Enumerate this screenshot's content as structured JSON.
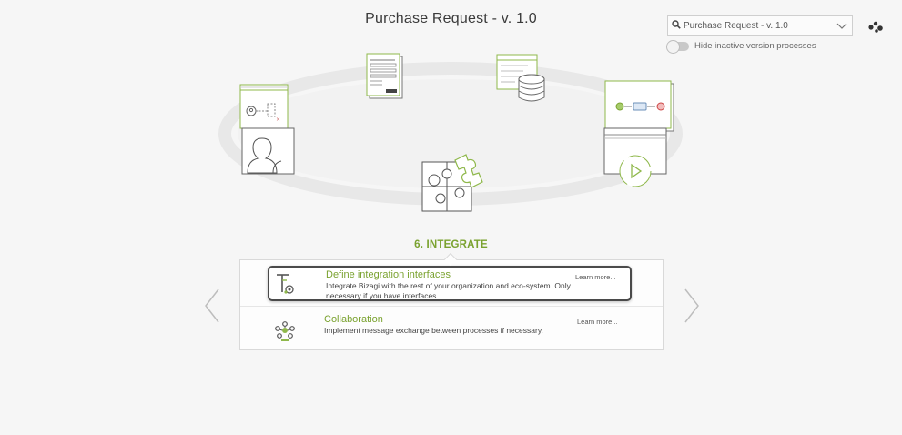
{
  "header": {
    "title": "Purchase Request - v. 1.0"
  },
  "version_selector": {
    "value": "Purchase Request - v. 1.0",
    "icon": "search-icon"
  },
  "hide_inactive": {
    "label": "Hide inactive version processes",
    "enabled": false
  },
  "stage": {
    "label": "6. INTEGRATE"
  },
  "steps": [
    {
      "title": "Define integration interfaces",
      "description": "Integrate Bizagi with the rest of your organization and eco-system. Only necessary if you have interfaces.",
      "more": "Learn more..."
    },
    {
      "title": "Collaboration",
      "description": "Implement message exchange between processes if necessary.",
      "more": "Learn more..."
    }
  ],
  "colors": {
    "accent": "#7aa22f",
    "ring": "#e4e4e4",
    "icon_line": "#555555"
  }
}
